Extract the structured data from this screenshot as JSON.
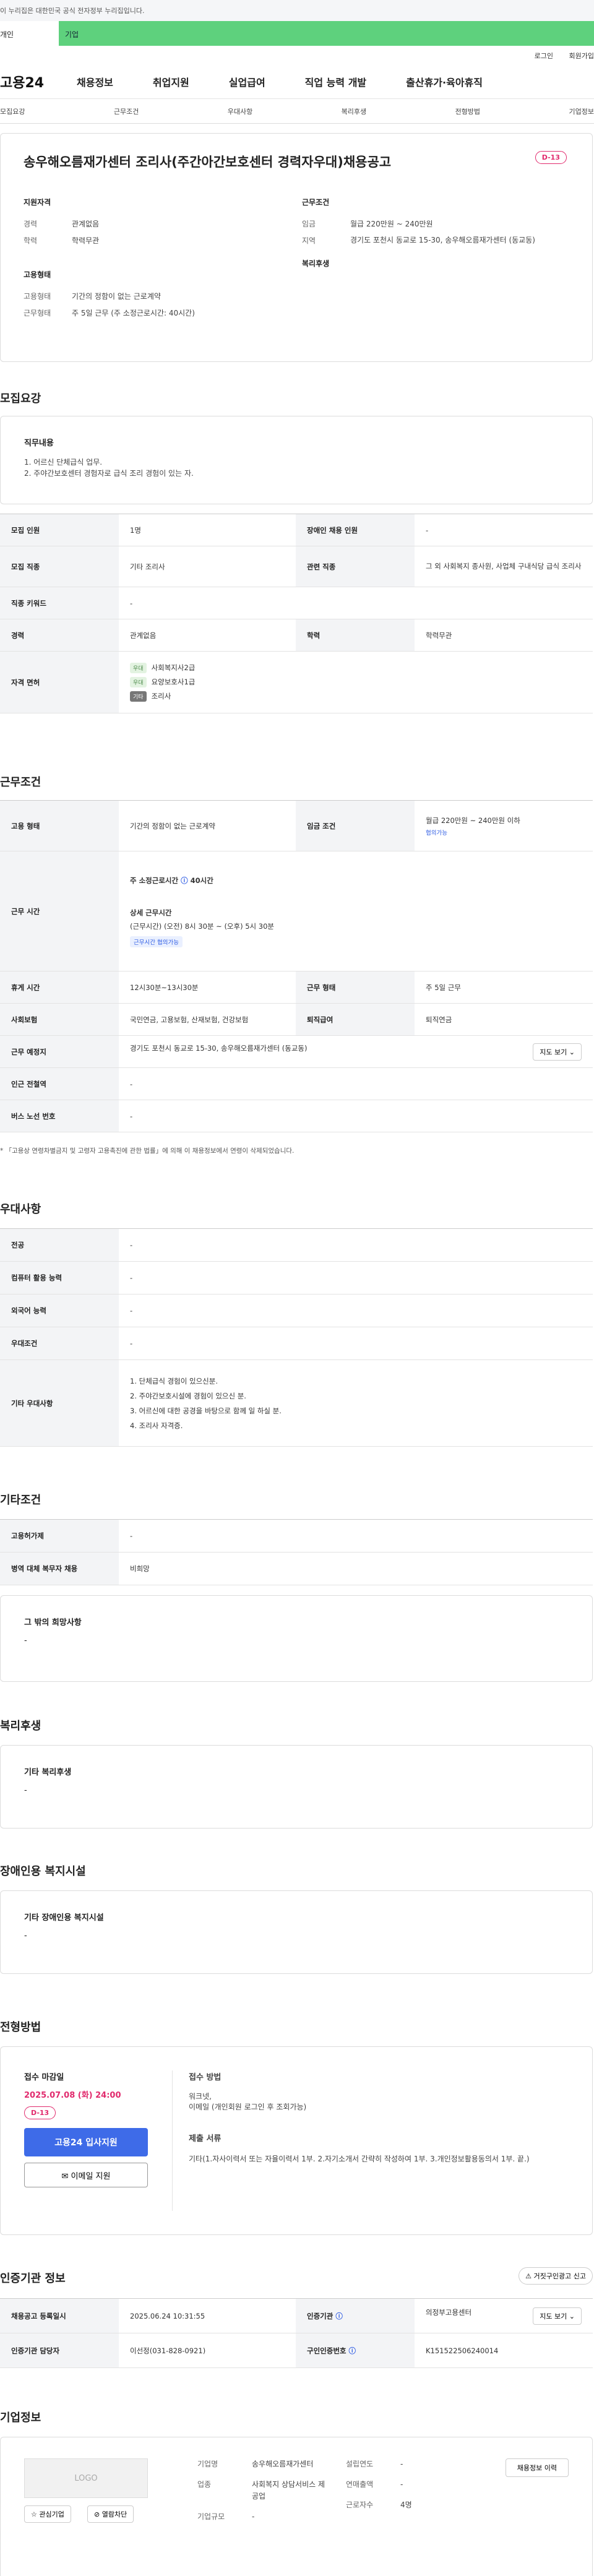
{
  "gov_banner": "이 누리집은 대한민국 공식 전자정부 누리집입니다.",
  "tab_personal": "개인",
  "tab_company": "기업",
  "login": "로그인",
  "join": "회원가입",
  "logo": "고용24",
  "gnb": [
    "채용정보",
    "취업지원",
    "실업급여",
    "직업 능력 개발",
    "출산휴가·육아휴직"
  ],
  "snb": [
    "모집요강",
    "근무조건",
    "우대사항",
    "복리후생",
    "전형방법",
    "기업정보"
  ],
  "title": "송우해오름재가센터 조리사(주간아간보호센터 경력자우대)채용공고",
  "dday": "D-13",
  "summary": {
    "qual_title": "지원자격",
    "cond_title": "근무조건",
    "emp_title": "고용형태",
    "wel_title": "복리후생",
    "k_exp": "경력",
    "v_exp": "관계없음",
    "k_edu": "학력",
    "v_edu": "학력무관",
    "k_pay": "임금",
    "v_pay": "월급 220만원 ~ 240만원",
    "k_loc": "지역",
    "v_loc": "경기도 포천시 동교로 15-30, 송우해오름재가센터 (동교동)",
    "k_type": "고용형태",
    "v_type": "기간의 정함이 없는 근로계약",
    "k_hours": "근무형태",
    "v_hours": "주 5일 근무 (주 소정근로시간: 40시간)"
  },
  "sec_recruit": "모집요강",
  "duty_title": "직무내용",
  "duty_1": "1. 어르신 단체급식 업무.",
  "duty_2": "2. 주야간보호센터 경험자로 급식 조리 경험이 있는 자.",
  "recruit": {
    "k_count": "모집 인원",
    "v_count": "1명",
    "k_dis": "장애인 채용 인원",
    "v_dis": "-",
    "k_job": "모집 직종",
    "v_job": "기타 조리사",
    "k_rel": "관련 직종",
    "v_rel": "그 외 사회복지 종사원, 사업체 구내식당 급식 조리사",
    "k_kw": "직종 키워드",
    "v_kw": "-",
    "k_exp": "경력",
    "v_exp": "관계없음",
    "k_edu": "학력",
    "v_edu": "학력무관",
    "k_lic": "자격 면허",
    "lic_badge1": "우대",
    "lic1": "사회복지사2급",
    "lic_badge2": "우대",
    "lic2": "요양보호사1급",
    "lic_badge3": "기타",
    "lic3": "조리사"
  },
  "sec_cond": "근무조건",
  "cond": {
    "k_type": "고용 형태",
    "v_type": "기간의 정함이 없는 근로계약",
    "k_pay": "임금 조건",
    "v_pay": "월급 220만원 ~ 240만원 이하",
    "pay_pill": "협의가능",
    "k_time": "근무 시간",
    "week_hours": "주 소정근로시간",
    "week_hours_v": "40시간",
    "detail_title": "상세 근무시간",
    "detail_v": "(근무시간) (오전) 8시 30분 ~ (오후) 5시 30분",
    "time_pill": "근무시간 협의가능",
    "k_rest": "휴게 시간",
    "v_rest": "12시30분~13시30분",
    "k_form": "근무 형태",
    "v_form": "주 5일 근무",
    "k_ins": "사회보험",
    "v_ins": "국민연금, 고용보험, 산재보험, 건강보험",
    "k_ret": "퇴직급여",
    "v_ret": "퇴직연금",
    "k_place": "근무 예정지",
    "v_place": "경기도 포천시 동교로 15-30, 송우해오름재가센터 (동교동)",
    "map_btn": "지도 보기",
    "k_sub": "인근 전철역",
    "v_sub": "-",
    "k_bus": "버스 노선 번호",
    "v_bus": "-"
  },
  "cond_note": "* 「고용상 연령차별금지 및 고령자 고용촉진에 관한 법률」에 의해 이 채용정보에서 연령이 삭제되었습니다.",
  "sec_pref": "우대사항",
  "pref": {
    "k_major": "전공",
    "v_major": "-",
    "k_pc": "컴퓨터 활용 능력",
    "v_pc": "-",
    "k_lang": "외국어 능력",
    "v_lang": "-",
    "k_cond": "우대조건",
    "v_cond": "-",
    "k_etc": "기타 우대사항",
    "etc1": "1. 단체급식 경험이 있으신분.",
    "etc2": "2. 주야간보호시설에 경험이 있으신 분.",
    "etc3": "3. 어르신에 대한 공경을 바탕으로 함께 일 하실 분.",
    "etc4": "4. 조리사 자격증."
  },
  "sec_etc": "기타조건",
  "etc": {
    "k_emp": "고용허가제",
    "v_emp": "-",
    "k_mil": "병역 대체 복무자 채용",
    "v_mil": "비희망"
  },
  "etc_box_title": "그 밖의 희망사항",
  "etc_box_v": "-",
  "sec_wel": "복리후생",
  "wel_box_title": "기타 복리후생",
  "wel_box_v": "-",
  "sec_dis": "장애인용 복지시설",
  "dis_box_title": "기타 장애인용 복지시설",
  "dis_box_v": "-",
  "sec_proc": "전형방법",
  "proc": {
    "deadline_title": "접수 마감일",
    "deadline": "2025.07.08 (화) 24:00",
    "dday": "D-13",
    "apply_btn": "고용24 입사지원",
    "email_btn": "이메일 지원",
    "method_title": "접수 방법",
    "method1": "워크넷,",
    "method2": "이메일 (개인회원 로그인 후 조회가능)",
    "docs_title": "제출 서류",
    "docs_v": "기타(1.자사이력서 또는 자율이력서 1부. 2.자기소개서 간략히 작성하여 1부. 3.개인정보활용동의서 1부. 끝.)"
  },
  "sec_cert": "인증기관 정보",
  "cert_report": "거짓구인광고 신고",
  "cert": {
    "k_date": "채용공고 등록일시",
    "v_date": "2025.06.24 10:31:55",
    "k_org": "인증기관",
    "v_org": "의정부고용센터",
    "map_btn": "지도 보기",
    "k_mgr": "인증기관 담당자",
    "v_mgr": "이선정(031-828-0921)",
    "k_no": "구인인증번호",
    "v_no": "K151522506240014"
  },
  "sec_comp": "기업정보",
  "comp": {
    "logo_ph": "LOGO",
    "fav_btn": "관심기업",
    "block_btn": "열람차단",
    "k_name": "기업명",
    "v_name": "송우해오름재가센터",
    "k_ind": "업종",
    "v_ind": "사회복지 상담서비스 제공업",
    "k_size": "기업규모",
    "v_size": "-",
    "k_year": "설립연도",
    "v_year": "-",
    "k_sales": "연매출액",
    "v_sales": "-",
    "k_staff": "근로자수",
    "v_staff": "4명",
    "info_btn": "채용정보 이력"
  }
}
